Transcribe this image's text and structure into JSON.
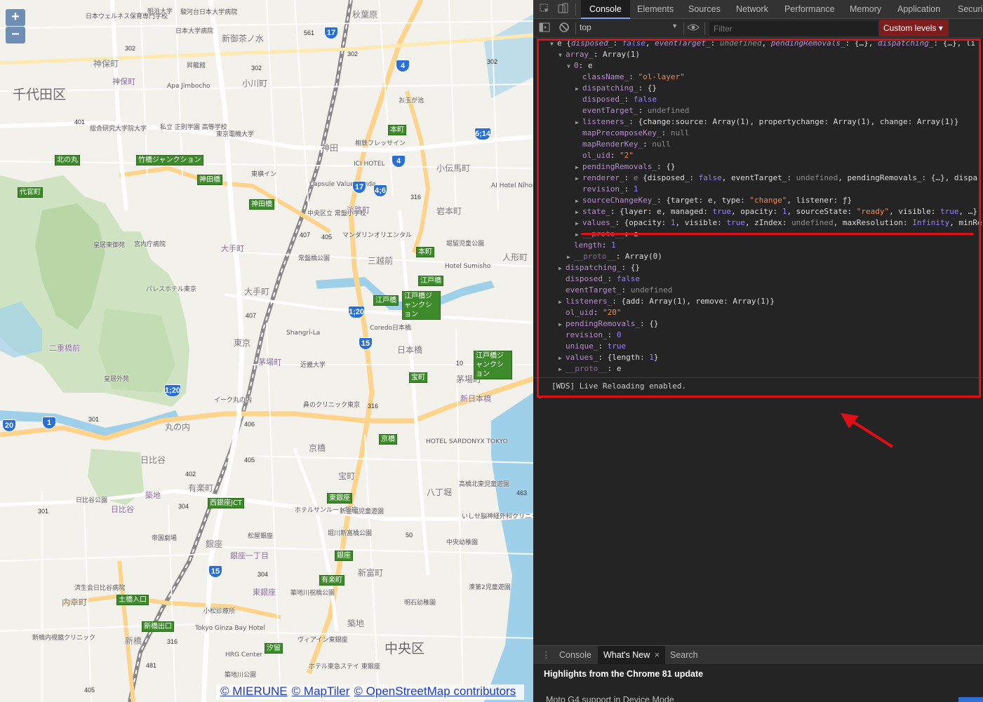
{
  "map": {
    "zoom_in": "+",
    "zoom_out": "−",
    "ward_labels": [
      "千代田区",
      "中央区"
    ],
    "area_labels": [
      "神保町",
      "小川町",
      "神田",
      "大手町",
      "日本橋",
      "京橋",
      "銀座",
      "東京",
      "丸の内",
      "日比谷",
      "新富町",
      "築地",
      "八丁堀",
      "茅場町",
      "人形町",
      "小伝馬町",
      "新御茶ノ水",
      "秋葉原",
      "宝町",
      "有楽町",
      "新橋",
      "内幸町",
      "三越前",
      "岩本町"
    ],
    "station_labels": [
      "神保町",
      "淡路町",
      "大手町",
      "二重橋前",
      "日比谷",
      "銀座一丁目",
      "東銀座",
      "築地",
      "新日本橋",
      "茅場町"
    ],
    "poi_labels": [
      "日本ウェルネス保育専門学校",
      "明治大学",
      "駿河台日本大学病院",
      "日本大学病院",
      "昇龍館",
      "Apa Jimbocho",
      "私立 正則学園 高等学校",
      "総合研究大学院大学",
      "東京電機大学",
      "相鉄フレッサイン",
      "お玉が池",
      "ICI HOTEL",
      "東横イン",
      "Capsule Value Kanda",
      "中央区立 常盤小学校",
      "マンダリンオリエンタル",
      "常盤橋公園",
      "皇居東御苑",
      "宮内庁病院",
      "パレスホテル東京",
      "Hotel Sumisho",
      "AI Hotel Nihonbashi",
      "堀留児童公園",
      "Coredo日本橋",
      "Shangri-La",
      "近畿大学",
      "鼻のクリニック東京",
      "HOTEL SARDONYX TOKYO",
      "イーク丸の内",
      "皇居外苑",
      "日比谷公園",
      "帝国劇場",
      "松屋銀座",
      "ホテルサンルート銀座",
      "新金幅児童遊園",
      "堀川新富橋公園",
      "いしせ脳神経外科クリニック",
      "中央幼稚園",
      "済生会日比谷病院",
      "小松診療所",
      "Tokyo Ginza Bay Hotel",
      "HRG Center",
      "築地川公園",
      "ホテル東急ステイ 東銀座",
      "ヴィアイン東銀座",
      "明石幼稚園",
      "築地川祝橋公園",
      "高橋北東児童遊園",
      "湊第2児童遊園",
      "新橋内視鏡クリニック"
    ],
    "junction_badges": [
      "竹橋ジャンクション",
      "神田橋",
      "代官町",
      "北の丸",
      "神田橋",
      "江戸橋",
      "江戸橋ジャンクション",
      "江戸橋",
      "京橋",
      "宝町",
      "東銀座",
      "銀座",
      "有楽町",
      "西銀座JCT",
      "土橋入口",
      "新橋出口",
      "江戸橋ジャンクション",
      "汐留",
      "本町",
      "本町"
    ],
    "route_numbers": [
      "17",
      "4",
      "4",
      "17",
      "4;6",
      "6;14",
      "1;20",
      "15",
      "1;20",
      "20",
      "1",
      "15"
    ],
    "road_numbers": [
      "302",
      "302",
      "561",
      "401",
      "302",
      "302",
      "316",
      "407",
      "405",
      "407",
      "316",
      "406",
      "405",
      "402",
      "304",
      "301",
      "301",
      "304",
      "50",
      "50",
      "316",
      "481",
      "405",
      "463",
      "10"
    ],
    "attribution": [
      "© MIERUNE",
      "© MapTiler",
      "© OpenStreetMap contributors"
    ]
  },
  "devtools": {
    "tabs": [
      "Console",
      "Elements",
      "Sources",
      "Network",
      "Performance",
      "Memory",
      "Application",
      "Securi"
    ],
    "active_tab": "Console",
    "context": "top",
    "filter_placeholder": "Filter",
    "levels": "Custom levels ▾",
    "console_lines": [
      {
        "indent": 0,
        "tri": "▼",
        "segs": [
          [
            "plain",
            "e "
          ],
          [
            "plain",
            "{"
          ],
          [
            "k it",
            "disposed_"
          ],
          [
            "plain",
            ": "
          ],
          [
            "bool it",
            "false"
          ],
          [
            "plain",
            ", "
          ],
          [
            "k it",
            "eventTarget_"
          ],
          [
            "plain",
            ": "
          ],
          [
            "undef it",
            "undefined"
          ],
          [
            "plain",
            ", "
          ],
          [
            "k it",
            "pendingRemovals_"
          ],
          [
            "plain",
            ": {…}, "
          ],
          [
            "k it",
            "dispatching_"
          ],
          [
            "plain",
            ": {…}, li"
          ]
        ]
      },
      {
        "indent": 1,
        "tri": "▼",
        "segs": [
          [
            "k",
            "array_"
          ],
          [
            "plain",
            ": Array(1)"
          ]
        ]
      },
      {
        "indent": 2,
        "tri": "▼",
        "segs": [
          [
            "k",
            "0"
          ],
          [
            "plain",
            ": e"
          ]
        ]
      },
      {
        "indent": 3,
        "tri": "",
        "segs": [
          [
            "k",
            "className_"
          ],
          [
            "plain",
            ": "
          ],
          [
            "str",
            "\"ol-layer\""
          ]
        ]
      },
      {
        "indent": 3,
        "tri": "▶",
        "segs": [
          [
            "k",
            "dispatching_"
          ],
          [
            "plain",
            ": {}"
          ]
        ]
      },
      {
        "indent": 3,
        "tri": "",
        "segs": [
          [
            "k",
            "disposed_"
          ],
          [
            "plain",
            ": "
          ],
          [
            "bool",
            "false"
          ]
        ]
      },
      {
        "indent": 3,
        "tri": "",
        "segs": [
          [
            "k",
            "eventTarget_"
          ],
          [
            "plain",
            ": "
          ],
          [
            "undef",
            "undefined"
          ]
        ]
      },
      {
        "indent": 3,
        "tri": "▶",
        "segs": [
          [
            "k",
            "listeners_"
          ],
          [
            "plain",
            ": {change:source: Array(1), propertychange: Array(1), change: Array(1)}"
          ]
        ]
      },
      {
        "indent": 3,
        "tri": "",
        "segs": [
          [
            "k",
            "mapPrecomposeKey_"
          ],
          [
            "plain",
            ": "
          ],
          [
            "undef",
            "null"
          ]
        ]
      },
      {
        "indent": 3,
        "tri": "",
        "segs": [
          [
            "k",
            "mapRenderKey_"
          ],
          [
            "plain",
            ": "
          ],
          [
            "undef",
            "null"
          ]
        ]
      },
      {
        "indent": 3,
        "tri": "",
        "segs": [
          [
            "k",
            "ol_uid"
          ],
          [
            "plain",
            ": "
          ],
          [
            "str",
            "\"2\""
          ]
        ]
      },
      {
        "indent": 3,
        "tri": "▶",
        "segs": [
          [
            "k",
            "pendingRemovals_"
          ],
          [
            "plain",
            ": {}"
          ]
        ]
      },
      {
        "indent": 3,
        "tri": "▶",
        "segs": [
          [
            "k",
            "renderer_"
          ],
          [
            "plain",
            ": "
          ],
          [
            "undef",
            "e"
          ],
          [
            "plain",
            " {disposed_: "
          ],
          [
            "bool",
            "false"
          ],
          [
            "plain",
            ", eventTarget_: "
          ],
          [
            "undef",
            "undefined"
          ],
          [
            "plain",
            ", pendingRemovals_: {…}, dispa"
          ]
        ]
      },
      {
        "indent": 3,
        "tri": "",
        "segs": [
          [
            "k",
            "revision_"
          ],
          [
            "plain",
            ": "
          ],
          [
            "num2",
            "1"
          ]
        ]
      },
      {
        "indent": 3,
        "tri": "▶",
        "segs": [
          [
            "k",
            "sourceChangeKey_"
          ],
          [
            "plain",
            ": {target: e, type: "
          ],
          [
            "str",
            "\"change\""
          ],
          [
            "plain",
            ", listener: ƒ}"
          ]
        ]
      },
      {
        "indent": 3,
        "tri": "▶",
        "segs": [
          [
            "k",
            "state_"
          ],
          [
            "plain",
            ": {layer: e, managed: "
          ],
          [
            "bool",
            "true"
          ],
          [
            "plain",
            ", opacity: "
          ],
          [
            "num2",
            "1"
          ],
          [
            "plain",
            ", sourceState: "
          ],
          [
            "str",
            "\"ready\""
          ],
          [
            "plain",
            ", visible: "
          ],
          [
            "bool",
            "true"
          ],
          [
            "plain",
            ", …}"
          ]
        ]
      },
      {
        "indent": 3,
        "tri": "▶",
        "segs": [
          [
            "k",
            "values_"
          ],
          [
            "plain",
            ": {opacity: "
          ],
          [
            "num2",
            "1"
          ],
          [
            "plain",
            ", visible: "
          ],
          [
            "bool",
            "true"
          ],
          [
            "plain",
            ", zIndex: "
          ],
          [
            "undef",
            "undefined"
          ],
          [
            "plain",
            ", maxResolution: "
          ],
          [
            "num2",
            "Infinity"
          ],
          [
            "plain",
            ", minRe"
          ]
        ]
      },
      {
        "indent": 3,
        "tri": "▶",
        "segs": [
          [
            "k dim",
            "__proto__"
          ],
          [
            "plain",
            ": e"
          ]
        ]
      },
      {
        "indent": 2,
        "tri": "",
        "segs": [
          [
            "k",
            "length"
          ],
          [
            "plain",
            ": "
          ],
          [
            "num2",
            "1"
          ]
        ]
      },
      {
        "indent": 2,
        "tri": "▶",
        "segs": [
          [
            "k dim",
            "__proto__"
          ],
          [
            "plain",
            ": Array(0)"
          ]
        ]
      },
      {
        "indent": 1,
        "tri": "▶",
        "segs": [
          [
            "k",
            "dispatching_"
          ],
          [
            "plain",
            ": {}"
          ]
        ]
      },
      {
        "indent": 1,
        "tri": "",
        "segs": [
          [
            "k",
            "disposed_"
          ],
          [
            "plain",
            ": "
          ],
          [
            "bool",
            "false"
          ]
        ]
      },
      {
        "indent": 1,
        "tri": "",
        "segs": [
          [
            "k",
            "eventTarget_"
          ],
          [
            "plain",
            ": "
          ],
          [
            "undef",
            "undefined"
          ]
        ]
      },
      {
        "indent": 1,
        "tri": "▶",
        "segs": [
          [
            "k",
            "listeners_"
          ],
          [
            "plain",
            ": {add: Array(1), remove: Array(1)}"
          ]
        ]
      },
      {
        "indent": 1,
        "tri": "",
        "segs": [
          [
            "k",
            "ol_uid"
          ],
          [
            "plain",
            ": "
          ],
          [
            "str",
            "\"20\""
          ]
        ]
      },
      {
        "indent": 1,
        "tri": "▶",
        "segs": [
          [
            "k",
            "pendingRemovals_"
          ],
          [
            "plain",
            ": {}"
          ]
        ]
      },
      {
        "indent": 1,
        "tri": "",
        "segs": [
          [
            "k",
            "revision_"
          ],
          [
            "plain",
            ": "
          ],
          [
            "num2",
            "0"
          ]
        ]
      },
      {
        "indent": 1,
        "tri": "",
        "segs": [
          [
            "k",
            "unique_"
          ],
          [
            "plain",
            ": "
          ],
          [
            "bool",
            "true"
          ]
        ]
      },
      {
        "indent": 1,
        "tri": "▶",
        "segs": [
          [
            "k",
            "values_"
          ],
          [
            "plain",
            ": {length: "
          ],
          [
            "num2",
            "1"
          ],
          [
            "plain",
            "}"
          ]
        ]
      },
      {
        "indent": 1,
        "tri": "▶",
        "segs": [
          [
            "k dim",
            "__proto__"
          ],
          [
            "plain",
            ": e"
          ]
        ]
      }
    ],
    "wds_message": "[WDS] Live Reloading enabled.",
    "drawer_tabs": [
      "Console",
      "What's New",
      "Search"
    ],
    "drawer_active": "What's New",
    "whatsnew_title": "Highlights from the Chrome 81 update",
    "whatsnew_item": "Moto G4 support in Device Mode",
    "highlight_color": "#e00f16"
  }
}
